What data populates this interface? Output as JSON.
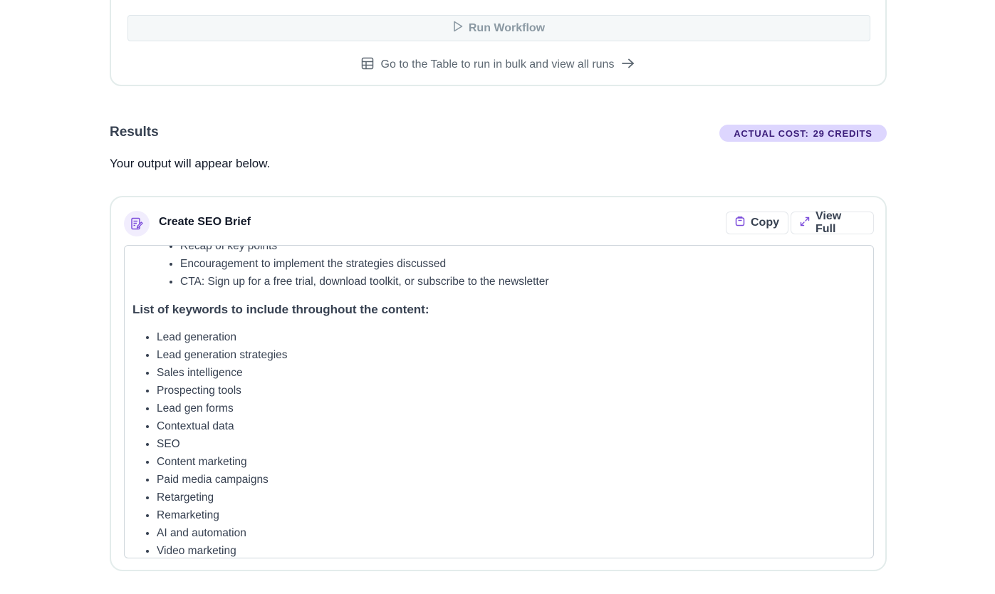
{
  "workflow": {
    "run_label": "Run Workflow",
    "table_link_label": "Go to the Table to run in bulk and view all runs"
  },
  "results": {
    "title": "Results",
    "cost_label": "ACTUAL COST:",
    "cost_value": "29 CREDITS",
    "subtitle": "Your output will appear below."
  },
  "output": {
    "step_title": "Create SEO Brief",
    "copy_label": "Copy",
    "view_full_label": "View Full",
    "top_bullets": [
      "Recap of key points",
      "Encouragement to implement the strategies discussed",
      "CTA: Sign up for a free trial, download toolkit, or subscribe to the newsletter"
    ],
    "keywords_heading": "List of keywords to include throughout the content:",
    "keywords": [
      "Lead generation",
      "Lead generation strategies",
      "Sales intelligence",
      "Prospecting tools",
      "Lead gen forms",
      "Contextual data",
      "SEO",
      "Content marketing",
      "Paid media campaigns",
      "Retargeting",
      "Remarketing",
      "AI and automation",
      "Video marketing"
    ]
  },
  "icons": {
    "run": "play-icon",
    "table": "table-icon",
    "arrow": "arrow-right-icon",
    "step": "edit-document-icon",
    "copy": "clipboard-icon",
    "view_full": "expand-icon"
  },
  "colors": {
    "accent_purple": "#7c4ddb",
    "badge_bg": "#ddd6fe",
    "badge_text": "#3b1d7a",
    "card_border": "#e3eceb"
  }
}
